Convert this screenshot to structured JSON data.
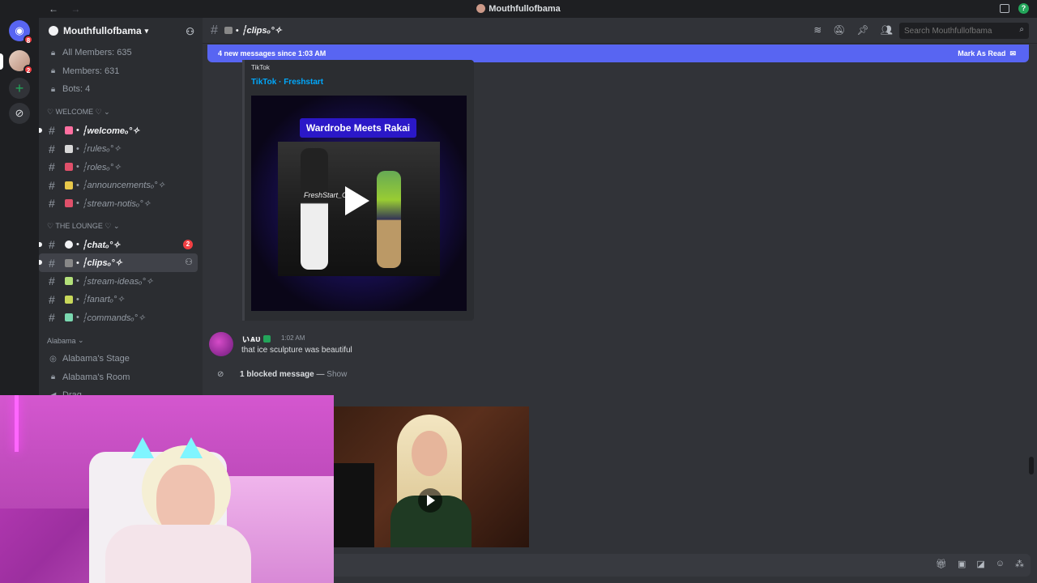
{
  "window": {
    "title": "Mouthfullofbama",
    "back": "←",
    "forward": "→",
    "help": "?"
  },
  "guilds": {
    "dm_badge": "8",
    "server_badge": "2"
  },
  "server": {
    "name": "Mouthfullofbama"
  },
  "sidebar": {
    "stats": [
      {
        "label": "All Members: 635"
      },
      {
        "label": "Members: 631"
      },
      {
        "label": "Bots: 4"
      }
    ],
    "categories": [
      {
        "name": "♡ WELCOME ♡",
        "channels": [
          {
            "name": "┆welcomeₒ°✧",
            "emoji_color": "#ff6fa0",
            "unread": true
          },
          {
            "name": "┆rulesₒ°✧",
            "emoji_color": "#d8d8d8"
          },
          {
            "name": "┆rolesₒ°✧",
            "emoji_color": "#e0506a"
          },
          {
            "name": "┆announcementsₒ°✧",
            "emoji_color": "#e8c84a"
          },
          {
            "name": "┆stream-notisₒ°✧",
            "emoji_color": "#e0506a"
          }
        ]
      },
      {
        "name": "♡ THE LOUNGE ♡",
        "channels": [
          {
            "name": "┆chatₒ°✧",
            "emoji_color": "#f2f3f5",
            "unread": true,
            "mentions": "2"
          },
          {
            "name": "┆clipsₒ°✧",
            "emoji_color": "#888",
            "unread": true,
            "active": true
          },
          {
            "name": "┆stream-ideasₒ°✧",
            "emoji_color": "#b3e07a"
          },
          {
            "name": "┆fanartₒ°✧",
            "emoji_color": "#c8d85a"
          },
          {
            "name": "┆commandsₒ°✧",
            "emoji_color": "#7ad8b0"
          }
        ]
      }
    ],
    "alabama": {
      "category": "Alabama",
      "items": [
        "Alabama's Stage",
        "Alabama's Room",
        "Drag"
      ]
    }
  },
  "channel": {
    "name": "┆clipsₒ°✧"
  },
  "search": {
    "placeholder": "Search Mouthfullofbama"
  },
  "new_messages": {
    "text": "4 new messages since 1:03 AM",
    "mark_read": "Mark As Read"
  },
  "embed": {
    "provider": "TikTok",
    "title": "TikTok · Freshstart",
    "video_caption": "Wardrobe Meets Rakai",
    "watermark": "FreshStart_Clips"
  },
  "message": {
    "author": "ぃѧᴜ",
    "time": "1:02 AM",
    "text": "that ice sculpture was beautiful"
  },
  "blocked": {
    "count_text": "1 blocked message",
    "sep": " — ",
    "show": "Show"
  },
  "colors": {
    "accent": "#5865f2",
    "link": "#00a8fc",
    "online": "#23a55a",
    "mention": "#f23f43"
  }
}
